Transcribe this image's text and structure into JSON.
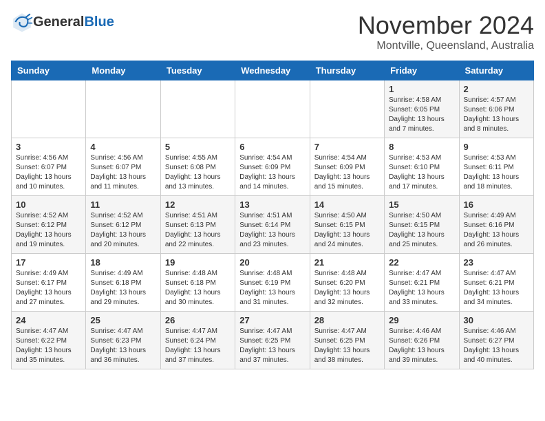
{
  "header": {
    "title": "November 2024",
    "subtitle": "Montville, Queensland, Australia",
    "logo_general": "General",
    "logo_blue": "Blue"
  },
  "weekdays": [
    "Sunday",
    "Monday",
    "Tuesday",
    "Wednesday",
    "Thursday",
    "Friday",
    "Saturday"
  ],
  "weeks": [
    [
      {
        "day": "",
        "info": ""
      },
      {
        "day": "",
        "info": ""
      },
      {
        "day": "",
        "info": ""
      },
      {
        "day": "",
        "info": ""
      },
      {
        "day": "",
        "info": ""
      },
      {
        "day": "1",
        "info": "Sunrise: 4:58 AM\nSunset: 6:05 PM\nDaylight: 13 hours\nand 7 minutes."
      },
      {
        "day": "2",
        "info": "Sunrise: 4:57 AM\nSunset: 6:06 PM\nDaylight: 13 hours\nand 8 minutes."
      }
    ],
    [
      {
        "day": "3",
        "info": "Sunrise: 4:56 AM\nSunset: 6:07 PM\nDaylight: 13 hours\nand 10 minutes."
      },
      {
        "day": "4",
        "info": "Sunrise: 4:56 AM\nSunset: 6:07 PM\nDaylight: 13 hours\nand 11 minutes."
      },
      {
        "day": "5",
        "info": "Sunrise: 4:55 AM\nSunset: 6:08 PM\nDaylight: 13 hours\nand 13 minutes."
      },
      {
        "day": "6",
        "info": "Sunrise: 4:54 AM\nSunset: 6:09 PM\nDaylight: 13 hours\nand 14 minutes."
      },
      {
        "day": "7",
        "info": "Sunrise: 4:54 AM\nSunset: 6:09 PM\nDaylight: 13 hours\nand 15 minutes."
      },
      {
        "day": "8",
        "info": "Sunrise: 4:53 AM\nSunset: 6:10 PM\nDaylight: 13 hours\nand 17 minutes."
      },
      {
        "day": "9",
        "info": "Sunrise: 4:53 AM\nSunset: 6:11 PM\nDaylight: 13 hours\nand 18 minutes."
      }
    ],
    [
      {
        "day": "10",
        "info": "Sunrise: 4:52 AM\nSunset: 6:12 PM\nDaylight: 13 hours\nand 19 minutes."
      },
      {
        "day": "11",
        "info": "Sunrise: 4:52 AM\nSunset: 6:12 PM\nDaylight: 13 hours\nand 20 minutes."
      },
      {
        "day": "12",
        "info": "Sunrise: 4:51 AM\nSunset: 6:13 PM\nDaylight: 13 hours\nand 22 minutes."
      },
      {
        "day": "13",
        "info": "Sunrise: 4:51 AM\nSunset: 6:14 PM\nDaylight: 13 hours\nand 23 minutes."
      },
      {
        "day": "14",
        "info": "Sunrise: 4:50 AM\nSunset: 6:15 PM\nDaylight: 13 hours\nand 24 minutes."
      },
      {
        "day": "15",
        "info": "Sunrise: 4:50 AM\nSunset: 6:15 PM\nDaylight: 13 hours\nand 25 minutes."
      },
      {
        "day": "16",
        "info": "Sunrise: 4:49 AM\nSunset: 6:16 PM\nDaylight: 13 hours\nand 26 minutes."
      }
    ],
    [
      {
        "day": "17",
        "info": "Sunrise: 4:49 AM\nSunset: 6:17 PM\nDaylight: 13 hours\nand 27 minutes."
      },
      {
        "day": "18",
        "info": "Sunrise: 4:49 AM\nSunset: 6:18 PM\nDaylight: 13 hours\nand 29 minutes."
      },
      {
        "day": "19",
        "info": "Sunrise: 4:48 AM\nSunset: 6:18 PM\nDaylight: 13 hours\nand 30 minutes."
      },
      {
        "day": "20",
        "info": "Sunrise: 4:48 AM\nSunset: 6:19 PM\nDaylight: 13 hours\nand 31 minutes."
      },
      {
        "day": "21",
        "info": "Sunrise: 4:48 AM\nSunset: 6:20 PM\nDaylight: 13 hours\nand 32 minutes."
      },
      {
        "day": "22",
        "info": "Sunrise: 4:47 AM\nSunset: 6:21 PM\nDaylight: 13 hours\nand 33 minutes."
      },
      {
        "day": "23",
        "info": "Sunrise: 4:47 AM\nSunset: 6:21 PM\nDaylight: 13 hours\nand 34 minutes."
      }
    ],
    [
      {
        "day": "24",
        "info": "Sunrise: 4:47 AM\nSunset: 6:22 PM\nDaylight: 13 hours\nand 35 minutes."
      },
      {
        "day": "25",
        "info": "Sunrise: 4:47 AM\nSunset: 6:23 PM\nDaylight: 13 hours\nand 36 minutes."
      },
      {
        "day": "26",
        "info": "Sunrise: 4:47 AM\nSunset: 6:24 PM\nDaylight: 13 hours\nand 37 minutes."
      },
      {
        "day": "27",
        "info": "Sunrise: 4:47 AM\nSunset: 6:25 PM\nDaylight: 13 hours\nand 37 minutes."
      },
      {
        "day": "28",
        "info": "Sunrise: 4:47 AM\nSunset: 6:25 PM\nDaylight: 13 hours\nand 38 minutes."
      },
      {
        "day": "29",
        "info": "Sunrise: 4:46 AM\nSunset: 6:26 PM\nDaylight: 13 hours\nand 39 minutes."
      },
      {
        "day": "30",
        "info": "Sunrise: 4:46 AM\nSunset: 6:27 PM\nDaylight: 13 hours\nand 40 minutes."
      }
    ]
  ]
}
